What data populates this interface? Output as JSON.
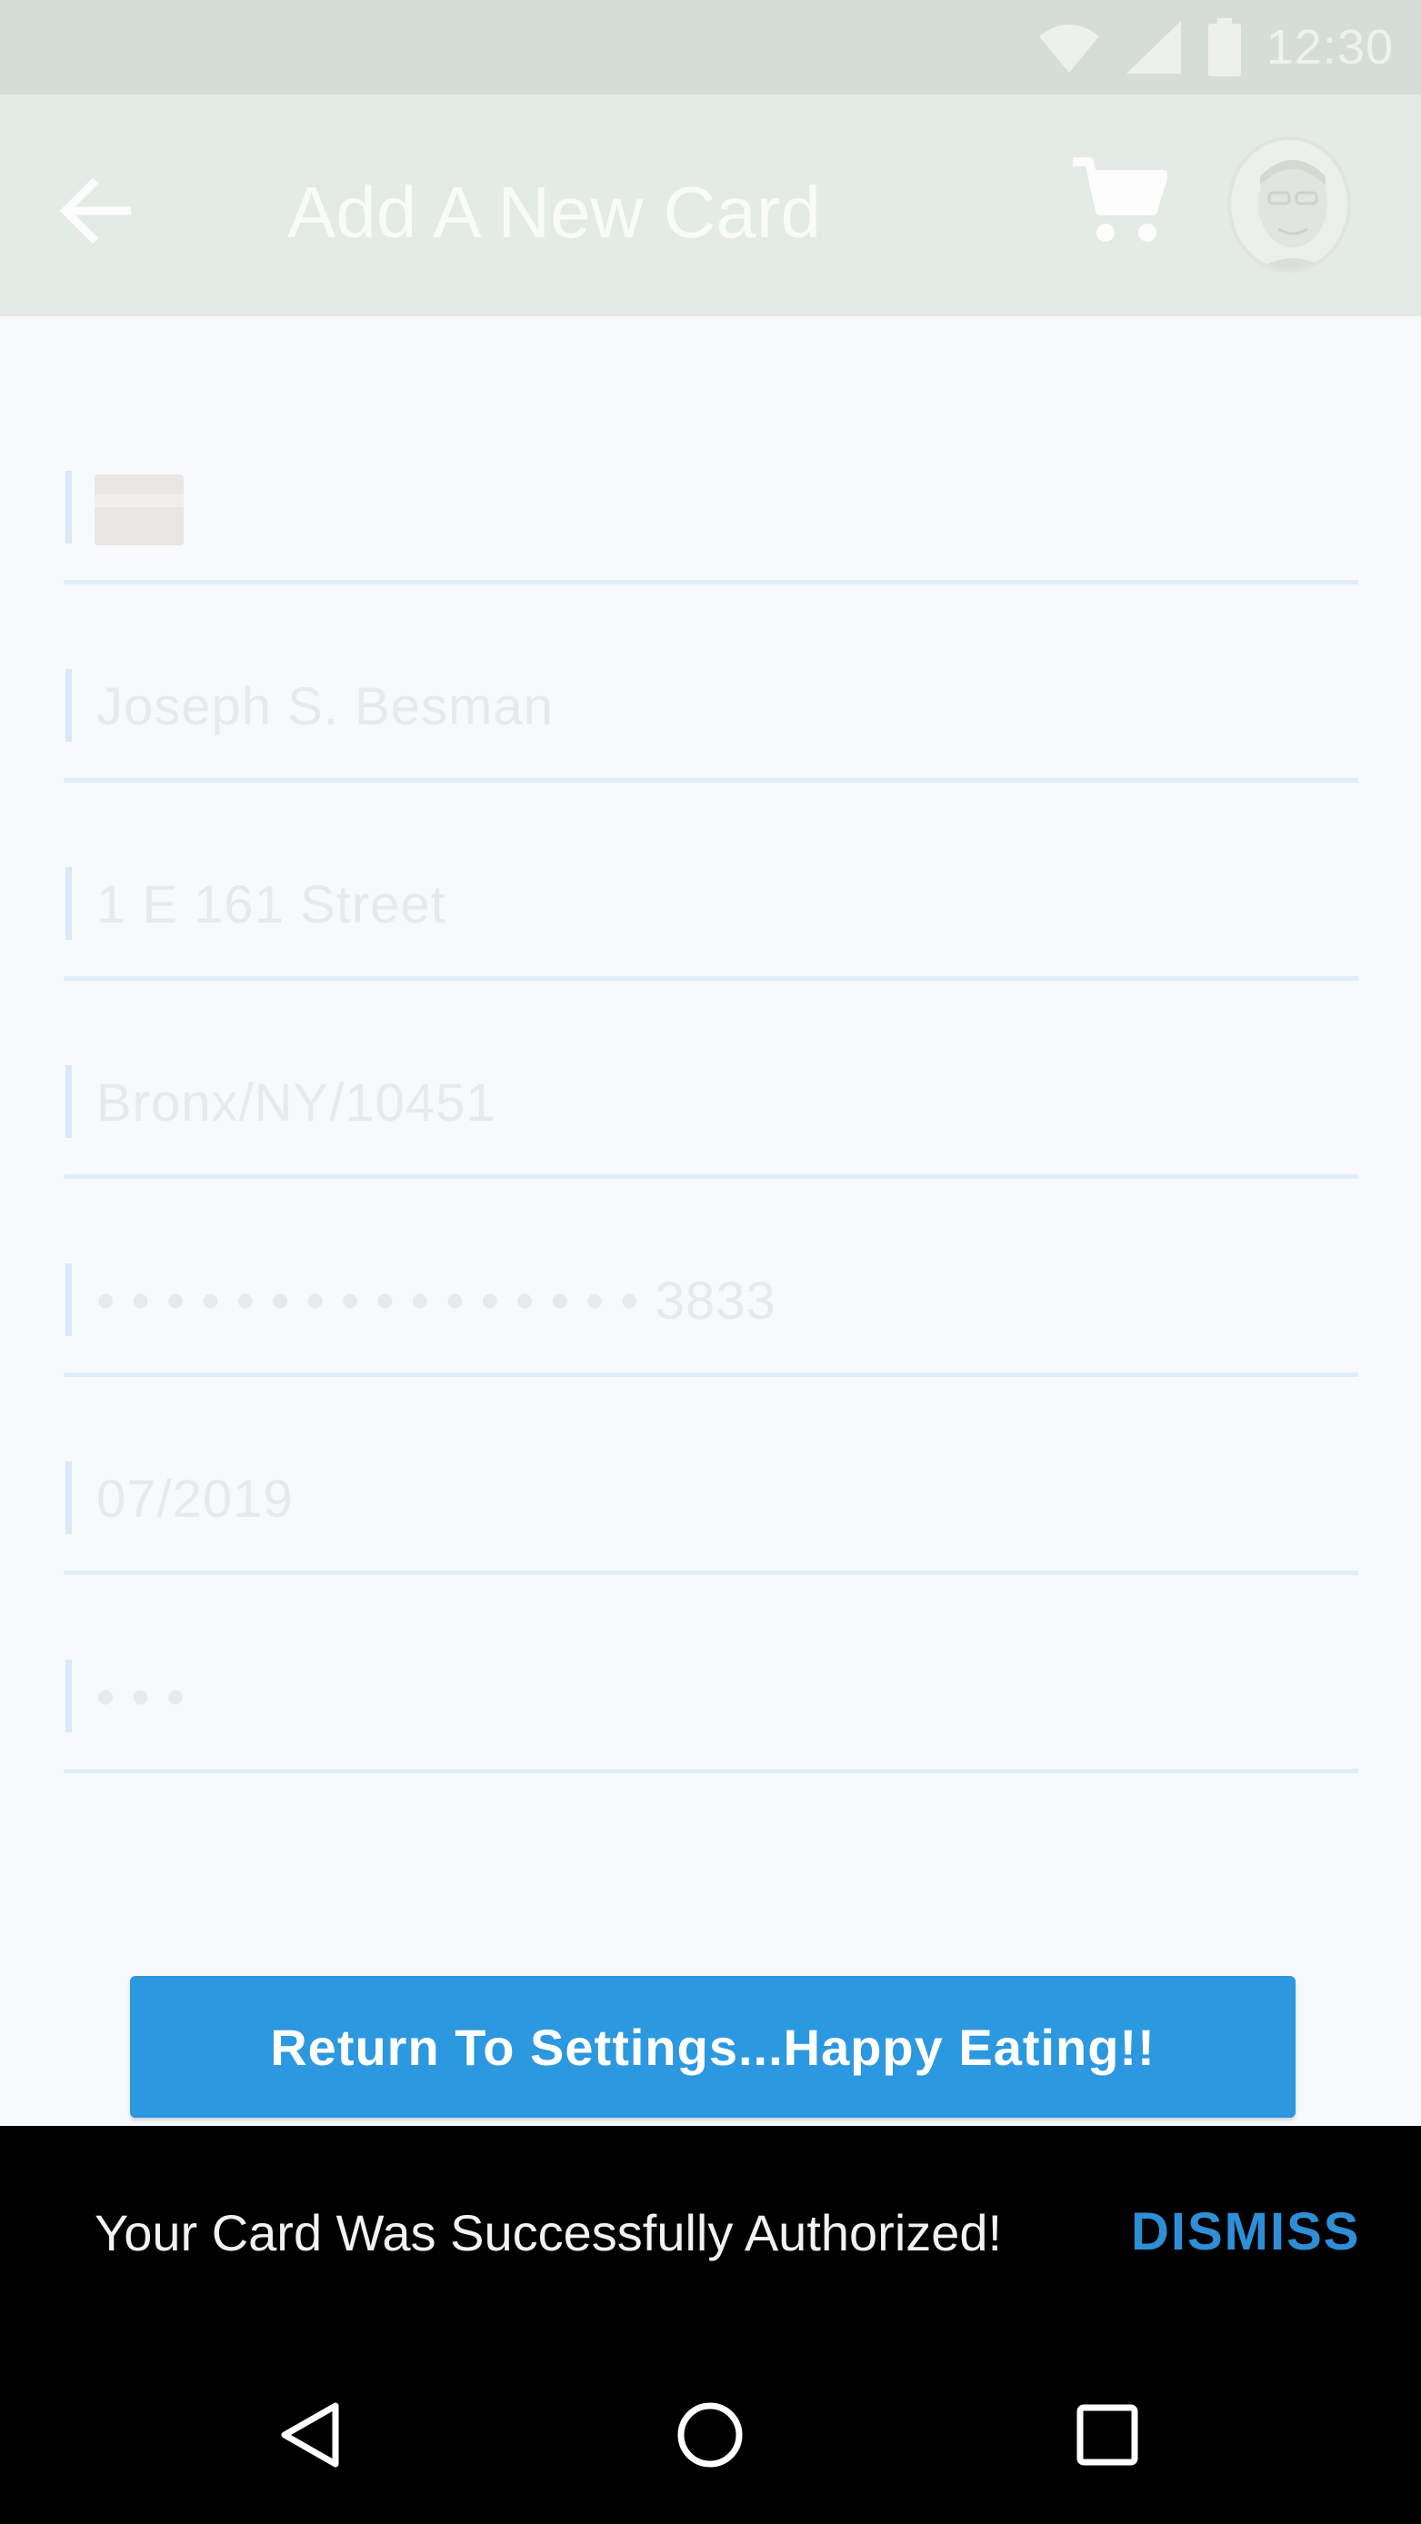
{
  "status_bar": {
    "time": "12:30",
    "icons": [
      "wifi-icon",
      "signal-icon",
      "battery-icon"
    ]
  },
  "app_bar": {
    "title": "Add A New Card",
    "back_icon": "arrow-back-icon",
    "cart_icon": "cart-icon",
    "avatar": "user-avatar"
  },
  "form": {
    "fields": [
      {
        "name": "card-type",
        "value": ""
      },
      {
        "name": "cardholder-name",
        "value": "Joseph S. Besman"
      },
      {
        "name": "street-address",
        "value": "1 E 161 Street"
      },
      {
        "name": "city-state-zip",
        "value": "Bronx/NY/10451"
      },
      {
        "name": "card-number",
        "value": "• • • • • • • • • • • • • • • • 3833"
      },
      {
        "name": "expiration-date",
        "value": "07/2019"
      },
      {
        "name": "cvv",
        "value": "• • •"
      }
    ]
  },
  "actions": {
    "return_label": "Return To Settings...Happy Eating!!"
  },
  "snackbar": {
    "message": "Your Card Was Successfully Authorized!",
    "dismiss_label": "DISMISS"
  },
  "nav_bar": {
    "buttons": [
      "nav-back-icon",
      "nav-home-icon",
      "nav-recents-icon"
    ]
  },
  "colors": {
    "primary": "#2b98e0",
    "accent": "#2e8fd6",
    "snackbar": "#000000"
  }
}
